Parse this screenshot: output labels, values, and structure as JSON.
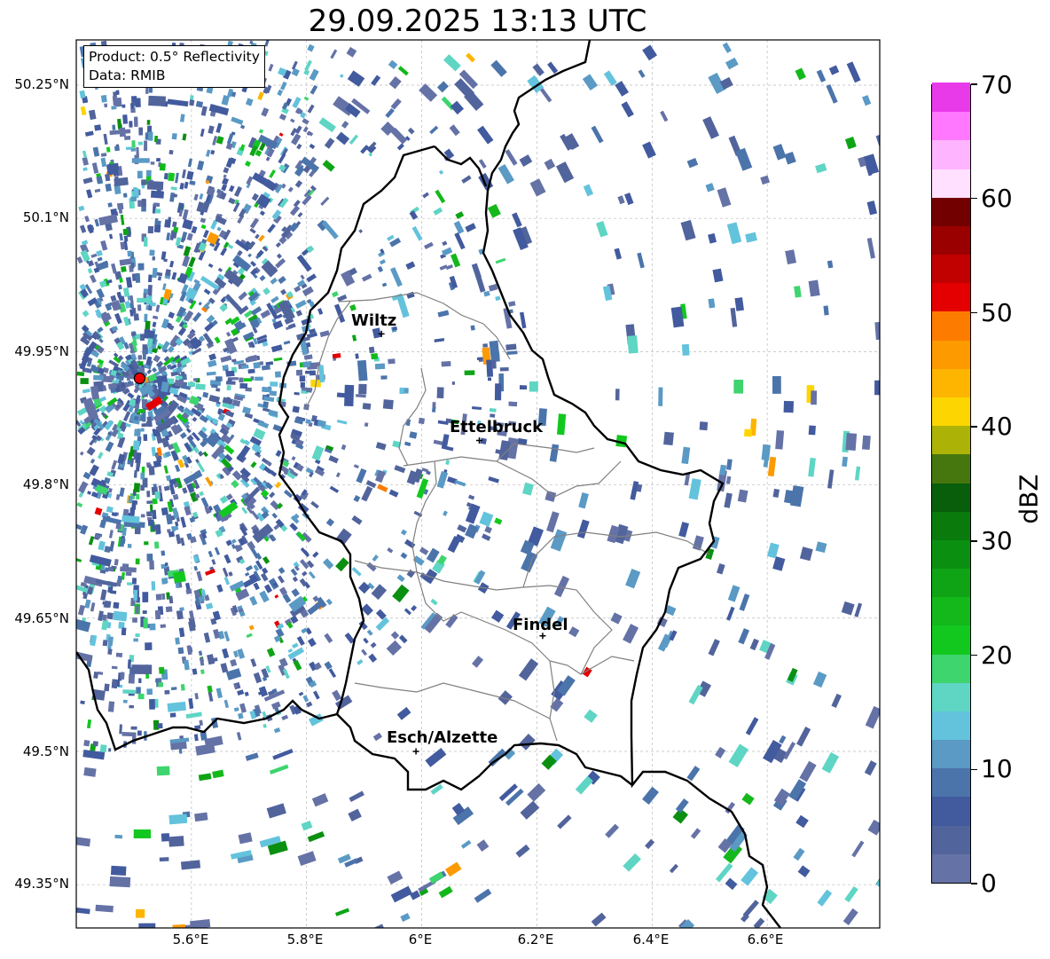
{
  "title": "29.09.2025 13:13 UTC",
  "info_box": {
    "product_line": "Product: 0.5° Reflectivity",
    "data_line": "Data: RMIB"
  },
  "axes": {
    "lat_labels": [
      "50.25°N",
      "50.1°N",
      "49.95°N",
      "49.8°N",
      "49.65°N",
      "49.5°N",
      "49.35°N"
    ],
    "lon_labels": [
      "5.6°E",
      "5.8°E",
      "6°E",
      "6.2°E",
      "6.4°E",
      "6.6°E"
    ]
  },
  "cities": [
    {
      "name": "Wiltz",
      "lon": 5.93,
      "lat": 49.97
    },
    {
      "name": "Ettelbruck",
      "lon": 6.1,
      "lat": 49.85
    },
    {
      "name": "Findel",
      "lon": 6.21,
      "lat": 49.63
    },
    {
      "name": "Esch/Alzette",
      "lon": 5.99,
      "lat": 49.5
    }
  ],
  "radar_site": {
    "lon": 5.51,
    "lat": 49.92,
    "color": "#ee0000"
  },
  "colorbar": {
    "label": "dBZ",
    "min": 0,
    "max": 70,
    "step": 2.5,
    "tick_labels": [
      "0",
      "10",
      "20",
      "30",
      "40",
      "50",
      "60",
      "70"
    ],
    "colors": [
      "#6572a6",
      "#52649c",
      "#425a9e",
      "#4b74ab",
      "#5a9ac5",
      "#63c3dc",
      "#5fd5c4",
      "#3ed46e",
      "#12c81f",
      "#14b81b",
      "#0ea416",
      "#0b8f11",
      "#0a7a0d",
      "#085e0a",
      "#45770e",
      "#adb306",
      "#fdd500",
      "#fdb500",
      "#fd9a00",
      "#fd7c00",
      "#e40000",
      "#c10000",
      "#9a0000",
      "#730000",
      "#ffe0ff",
      "#ffb4ff",
      "#ff78ff",
      "#e93aea"
    ]
  }
}
